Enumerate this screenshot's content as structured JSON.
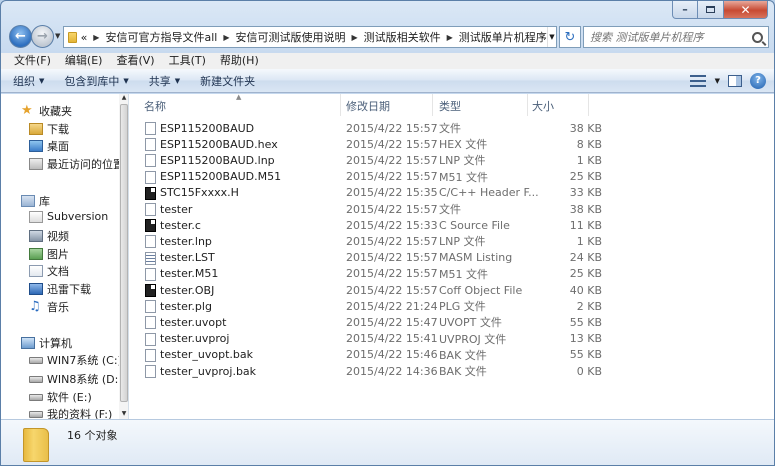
{
  "window": {
    "caption": {
      "minimize": "–",
      "close": "✕"
    }
  },
  "address_bar": {
    "prefix": "«",
    "crumbs": [
      "安信可官方指导文件all",
      "安信可测试版使用说明",
      "测试版相关软件",
      "测试版单片机程序"
    ],
    "dropdown": "▼",
    "refresh_symbol": "↻"
  },
  "search": {
    "placeholder": "搜索 测试版单片机程序"
  },
  "menu": [
    "文件(F)",
    "编辑(E)",
    "查看(V)",
    "工具(T)",
    "帮助(H)"
  ],
  "commands": [
    {
      "label": "组织",
      "arrow": "▼"
    },
    {
      "label": "包含到库中",
      "arrow": "▼"
    },
    {
      "label": "共享",
      "arrow": "▼"
    },
    {
      "label": "新建文件夹",
      "arrow": ""
    }
  ],
  "help_symbol": "?",
  "nav": {
    "favorites": {
      "label": "收藏夹",
      "items": [
        "下载",
        "桌面",
        "最近访问的位置"
      ]
    },
    "libraries": {
      "label": "库",
      "items": [
        "Subversion",
        "视频",
        "图片",
        "文档",
        "迅雷下载",
        "音乐"
      ]
    },
    "computer": {
      "label": "计算机",
      "items": [
        "WIN7系统 (C:)",
        "WIN8系统 (D:)",
        "软件 (E:)",
        "我的资料 (F:)"
      ]
    },
    "scroll_up": "▲",
    "scroll_down": "▼"
  },
  "columns": {
    "name": "名称",
    "date": "修改日期",
    "type": "类型",
    "size": "大小",
    "sort_indicator": "▲"
  },
  "files": [
    {
      "name": "ESP115200BAUD",
      "date": "2015/4/22 15:57",
      "type": "文件",
      "size": "38 KB",
      "icon": "blank"
    },
    {
      "name": "ESP115200BAUD.hex",
      "date": "2015/4/22 15:57",
      "type": "HEX 文件",
      "size": "8 KB",
      "icon": "blank"
    },
    {
      "name": "ESP115200BAUD.lnp",
      "date": "2015/4/22 15:57",
      "type": "LNP 文件",
      "size": "1 KB",
      "icon": "blank"
    },
    {
      "name": "ESP115200BAUD.M51",
      "date": "2015/4/22 15:57",
      "type": "M51 文件",
      "size": "25 KB",
      "icon": "blank"
    },
    {
      "name": "STC15Fxxxx.H",
      "date": "2015/4/22 15:35",
      "type": "C/C++ Header F...",
      "size": "33 KB",
      "icon": "dark"
    },
    {
      "name": "tester",
      "date": "2015/4/22 15:57",
      "type": "文件",
      "size": "38 KB",
      "icon": "blank"
    },
    {
      "name": "tester.c",
      "date": "2015/4/22 15:33",
      "type": "C Source File",
      "size": "11 KB",
      "icon": "dark"
    },
    {
      "name": "tester.lnp",
      "date": "2015/4/22 15:57",
      "type": "LNP 文件",
      "size": "1 KB",
      "icon": "blank"
    },
    {
      "name": "tester.LST",
      "date": "2015/4/22 15:57",
      "type": "MASM Listing",
      "size": "24 KB",
      "icon": "lines"
    },
    {
      "name": "tester.M51",
      "date": "2015/4/22 15:57",
      "type": "M51 文件",
      "size": "25 KB",
      "icon": "blank"
    },
    {
      "name": "tester.OBJ",
      "date": "2015/4/22 15:57",
      "type": "Coff Object File",
      "size": "40 KB",
      "icon": "dark"
    },
    {
      "name": "tester.plg",
      "date": "2015/4/22 21:24",
      "type": "PLG 文件",
      "size": "2 KB",
      "icon": "blank"
    },
    {
      "name": "tester.uvopt",
      "date": "2015/4/22 15:47",
      "type": "UVOPT 文件",
      "size": "55 KB",
      "icon": "blank"
    },
    {
      "name": "tester.uvproj",
      "date": "2015/4/22 15:41",
      "type": "UVPROJ 文件",
      "size": "13 KB",
      "icon": "blank"
    },
    {
      "name": "tester_uvopt.bak",
      "date": "2015/4/22 15:46",
      "type": "BAK 文件",
      "size": "55 KB",
      "icon": "blank"
    },
    {
      "name": "tester_uvproj.bak",
      "date": "2015/4/22 14:36",
      "type": "BAK 文件",
      "size": "0 KB",
      "icon": "blank"
    }
  ],
  "status": {
    "count": "16 个对象"
  }
}
